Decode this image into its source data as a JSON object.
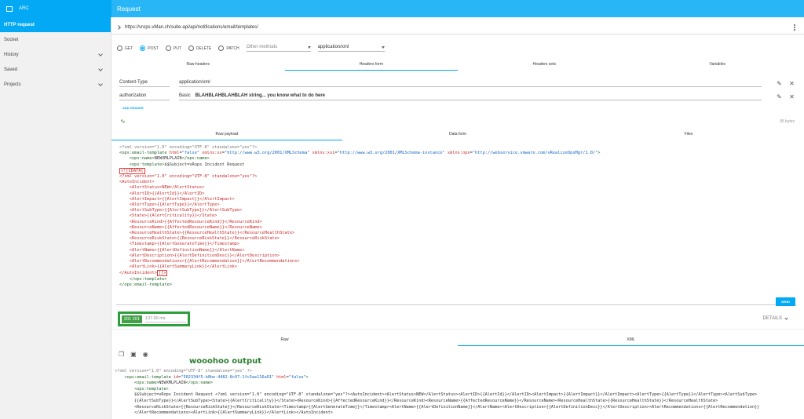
{
  "app": {
    "name": "ARC",
    "page_title": "Request"
  },
  "sidebar": {
    "items": [
      {
        "label": "HTTP request",
        "active": true,
        "expandable": false
      },
      {
        "label": "Socket",
        "active": false,
        "expandable": false
      },
      {
        "label": "History",
        "active": false,
        "expandable": true
      },
      {
        "label": "Saved",
        "active": false,
        "expandable": true
      },
      {
        "label": "Projects",
        "active": false,
        "expandable": true
      }
    ]
  },
  "request": {
    "url": "https://vrops.vMan.ch/suite-api/api/notifications/email/templates/"
  },
  "methods": {
    "options": [
      "GET",
      "POST",
      "PUT",
      "DELETE",
      "PATCH"
    ],
    "selected": "POST",
    "other_placeholder": "Other methods",
    "content_type": "application/xml"
  },
  "header_tabs": [
    "Raw headers",
    "Headers form",
    "Headers sets",
    "Variables"
  ],
  "headers": [
    {
      "name": "Content-Type",
      "value": "application/xml",
      "extra": ""
    },
    {
      "name": "authorization",
      "value": "Basic",
      "extra": "BLAHBLAHBLAHBLAH string... you know what to do here"
    }
  ],
  "add_header_label": "ADD HEADER",
  "payload_size": "95 bytes",
  "payload_tabs": [
    "Raw payload",
    "Data form",
    "Files"
  ],
  "send_label": "SEND",
  "response": {
    "status": "201 201",
    "time": "137.00 ms",
    "details_label": "DETAILS",
    "tabs": [
      "Raw",
      "XML"
    ],
    "annotation": "wooohoo output"
  },
  "colors": {
    "accent": "#03a9f4",
    "header": "#29b6f6",
    "status_green": "#43a047",
    "highlight_box": "#2e9e3d"
  }
}
